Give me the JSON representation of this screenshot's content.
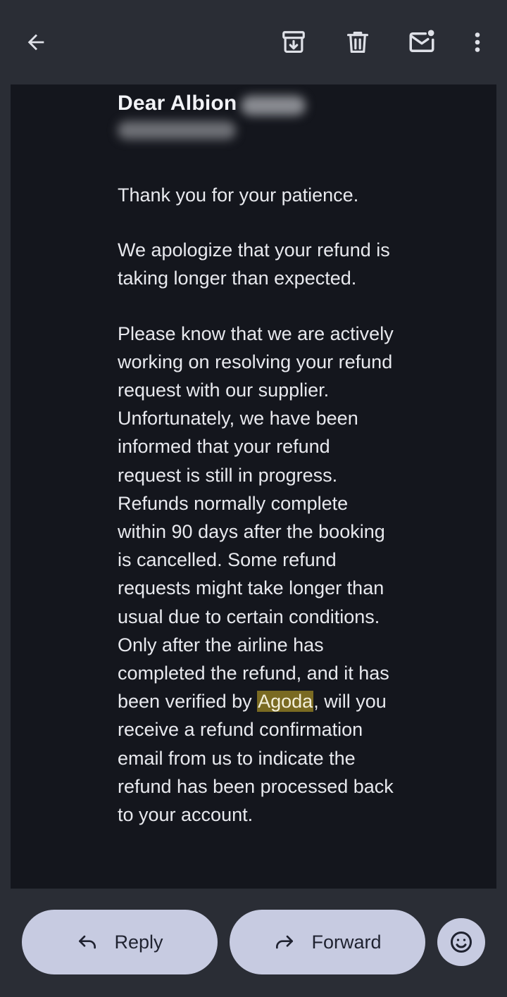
{
  "toolbar": {
    "back_icon": "arrow-back-icon",
    "archive_icon": "archive-icon",
    "delete_icon": "trash-icon",
    "mark_unread_icon": "mail-unread-icon",
    "more_icon": "more-vert-icon"
  },
  "email": {
    "greeting": "Dear Albion",
    "body": {
      "line1": "Thank you for your patience.",
      "line2": "We apologize that your refund is taking longer than expected.",
      "para3": "Please know that we are actively working on resolving your refund request with our supplier. Unfortunately, we have been informed that your refund request is still in progress.",
      "para4_before": "Refunds normally complete within 90 days after the booking is cancelled. Some refund requests might take longer than usual due to certain conditions. Only after the airline has completed the refund, and it has been verified by ",
      "para4_highlight": "Agoda",
      "para4_after": ", will you receive a refund confirmation email from us to indicate the refund has been processed back to your account."
    },
    "highlight_color": "#7a6a22"
  },
  "actions": {
    "reply_label": "Reply",
    "forward_label": "Forward",
    "reply_icon": "reply-icon",
    "forward_icon": "forward-icon",
    "emoji_icon": "emoji-smile-icon"
  },
  "colors": {
    "bar_background": "#2a2d35",
    "email_background": "#14161d",
    "pill_background": "#c7cbe1"
  }
}
